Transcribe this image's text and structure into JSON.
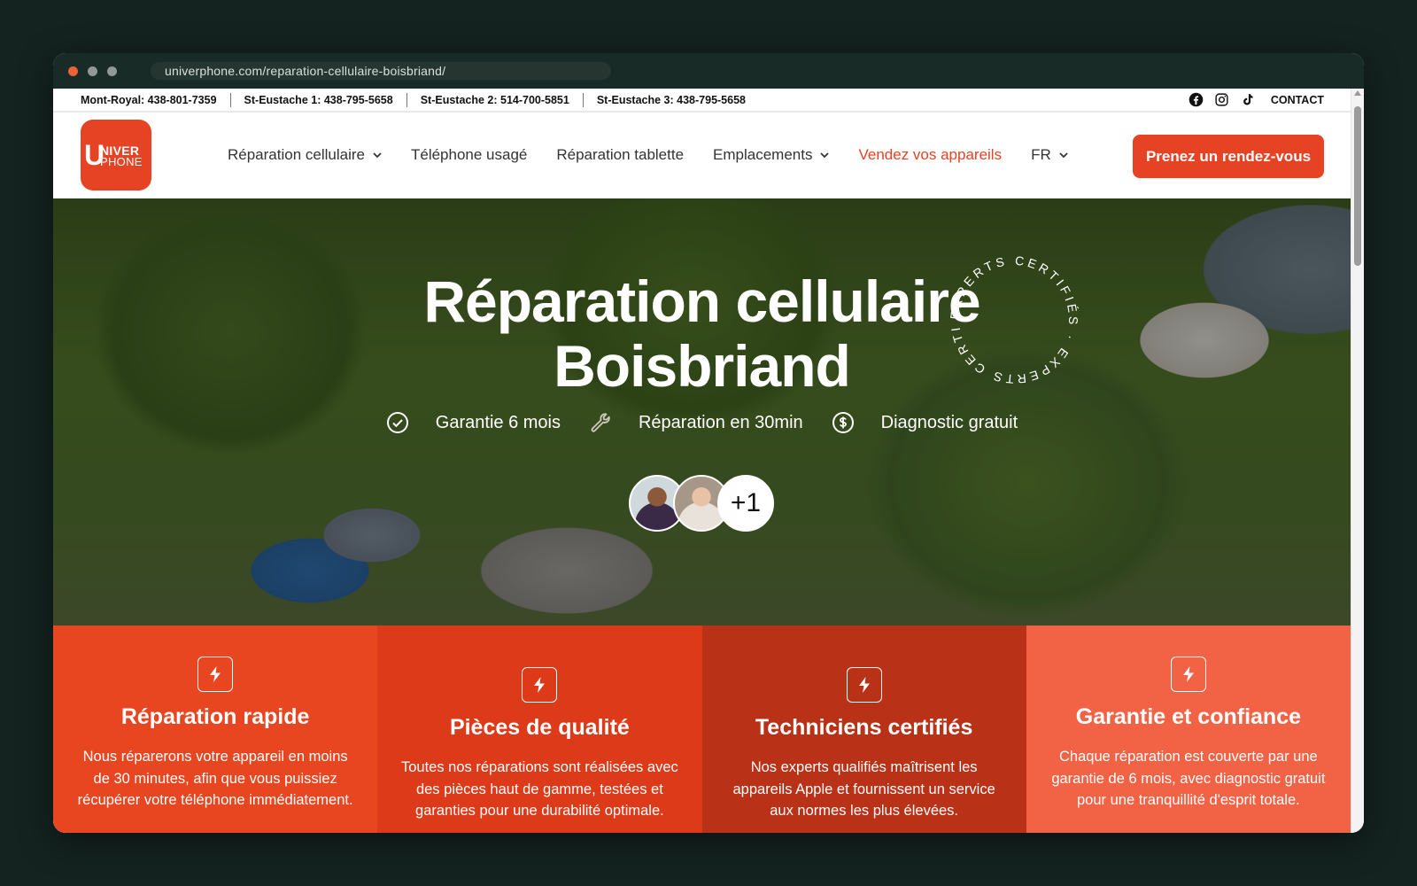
{
  "browser": {
    "url": "univerphone.com/reparation-cellulaire-boisbriand/",
    "dots": [
      "#e9623a",
      "#8f9a96",
      "#8f9a96"
    ]
  },
  "topbar": {
    "phones": [
      "Mont-Royal: 438-801-7359",
      "St-Eustache 1: 438-795-5658",
      "St-Eustache 2: 514-700-5851",
      "St-Eustache 3: 438-795-5658"
    ],
    "social_icons": [
      "facebook-icon",
      "instagram-icon",
      "tiktok-icon"
    ],
    "contact": "CONTACT"
  },
  "logo": {
    "u": "U",
    "top": "NIVER",
    "bottom": "PHONE"
  },
  "nav": {
    "items": [
      {
        "label": "Réparation cellulaire",
        "dropdown": true
      },
      {
        "label": "Téléphone usagé",
        "dropdown": false
      },
      {
        "label": "Réparation tablette",
        "dropdown": false
      },
      {
        "label": "Emplacements",
        "dropdown": true
      },
      {
        "label": "Vendez vos appareils",
        "dropdown": false
      },
      {
        "label": "FR",
        "dropdown": true
      }
    ],
    "cta": "Prenez un rendez-vous"
  },
  "hero": {
    "title_line1": "Réparation cellulaire",
    "title_line2": "Boisbriand",
    "features": [
      {
        "icon": "check-circle-icon",
        "label": "Garantie 6 mois"
      },
      {
        "icon": "wrench-icon",
        "label": "Réparation en 30min"
      },
      {
        "icon": "dollar-circle-icon",
        "label": "Diagnostic gratuit"
      }
    ],
    "avatars_more": "+1",
    "badge_text": "EXPERTS CERTIFIÉS · EXPERTS CERTIFIÉS · "
  },
  "cards": [
    {
      "title": "Réparation rapide",
      "text": "Nous réparerons votre appareil en moins de 30 minutes, afin que vous puissiez récupérer votre téléphone immédiatement.",
      "icon": "lightning-icon"
    },
    {
      "title": "Pièces de qualité",
      "text": "Toutes nos réparations sont réalisées avec des pièces haut de gamme, testées et garanties pour une durabilité optimale.",
      "icon": "lightning-icon"
    },
    {
      "title": "Techniciens certifiés",
      "text": "Nos experts qualifiés maîtrisent les appareils Apple et fournissent un service aux normes les plus élevées.",
      "icon": "lightning-icon"
    },
    {
      "title": "Garantie et confiance",
      "text": "Chaque réparation est couverte par une garantie de 6 mois, avec diagnostic gratuit pour une tranquillité d'esprit totale.",
      "icon": "lightning-icon"
    }
  ],
  "colors": {
    "brand": "#e64324",
    "sell_link": "#e64324"
  }
}
